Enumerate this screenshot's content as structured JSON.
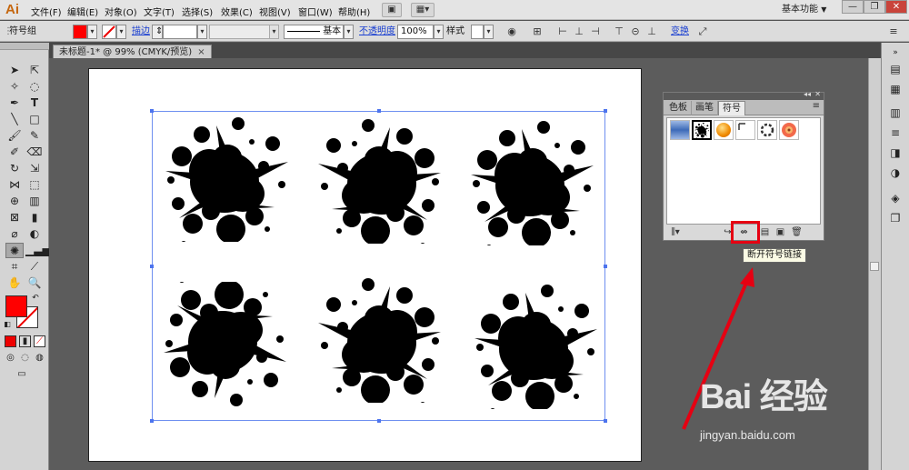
{
  "app": {
    "logo": "Ai",
    "workspace": "基本功能",
    "workspace_arrow": "▼"
  },
  "menus": [
    "文件(F)",
    "编辑(E)",
    "对象(O)",
    "文字(T)",
    "选择(S)",
    "效果(C)",
    "视图(V)",
    "窗口(W)",
    "帮助(H)"
  ],
  "window_controls": {
    "minimize": "—",
    "restore": "❐",
    "close": "✕"
  },
  "control_bar": {
    "selection_label": "符号组",
    "stroke_label": "描边",
    "stroke_style": "基本",
    "opacity_label": "不透明度",
    "opacity_value": "100%",
    "style_label": "样式",
    "transform_label": "变换",
    "colors": {
      "fill": "#ff0000"
    }
  },
  "document": {
    "tab_title": "未标题-1* @ 99% (CMYK/预览)",
    "close": "×"
  },
  "symbols_panel": {
    "tabs": [
      "色板",
      "画笔",
      "符号"
    ],
    "active_tab": "符号",
    "tooltip": "断开符号链接",
    "highlight_color": "#e60012"
  },
  "watermark": {
    "brand": "Bai 经验",
    "url": "jingyan.baidu.com"
  }
}
